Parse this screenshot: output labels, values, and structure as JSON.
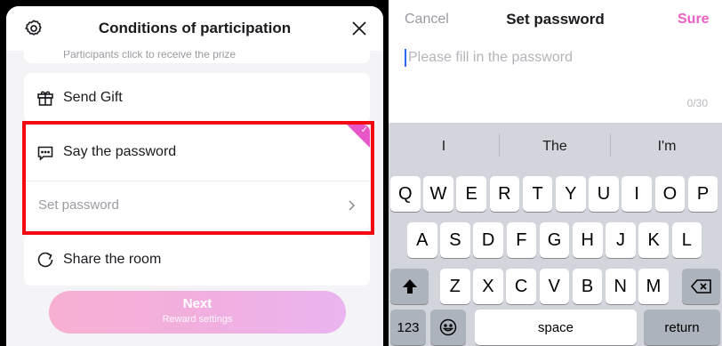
{
  "left_panel": {
    "title": "Conditions of participation",
    "truncated_text": "Participants click to receive the prize",
    "rows": {
      "send_gift": "Send Gift",
      "say_password": "Say the password",
      "set_password": "Set password",
      "share_room": "Share the room"
    },
    "next_button": {
      "label": "Next",
      "sublabel": "Reward settings"
    },
    "colors": {
      "highlight_border": "#f40a12",
      "accent": "#e857c8"
    }
  },
  "right_panel": {
    "cancel": "Cancel",
    "title": "Set password",
    "sure": "Sure",
    "input": {
      "placeholder": "Please fill in the password",
      "value": ""
    },
    "counter": "0/30"
  },
  "keyboard": {
    "suggestions": [
      "I",
      "The",
      "I'm"
    ],
    "row1": [
      "Q",
      "W",
      "E",
      "R",
      "T",
      "Y",
      "U",
      "I",
      "O",
      "P"
    ],
    "row2": [
      "A",
      "S",
      "D",
      "F",
      "G",
      "H",
      "J",
      "K",
      "L"
    ],
    "row3": [
      "Z",
      "X",
      "C",
      "V",
      "B",
      "N",
      "M"
    ],
    "numbers_key": "123",
    "space_key": "space",
    "return_key": "return"
  }
}
